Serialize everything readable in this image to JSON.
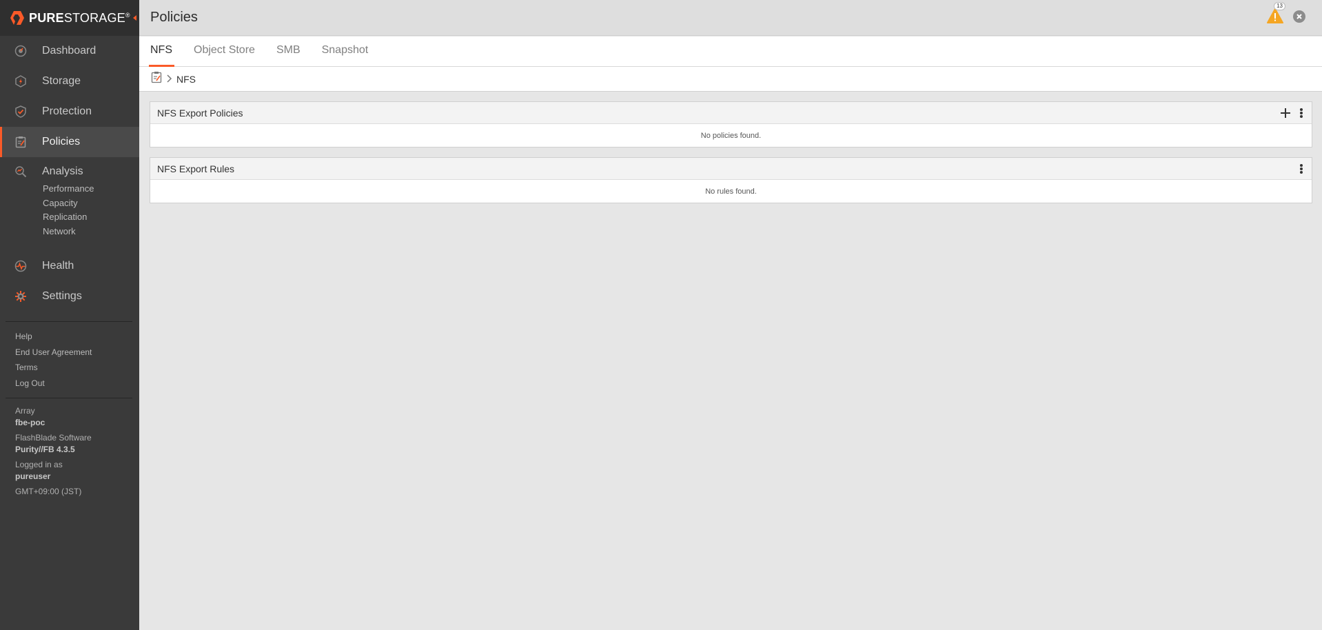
{
  "brand": {
    "name_bold": "PURE",
    "name_regular": "STORAGE",
    "mark": "®",
    "accent": "#fa5a28"
  },
  "sidebar": {
    "items": [
      {
        "label": "Dashboard",
        "icon": "dashboard-icon"
      },
      {
        "label": "Storage",
        "icon": "storage-icon"
      },
      {
        "label": "Protection",
        "icon": "protection-icon"
      },
      {
        "label": "Policies",
        "icon": "policies-icon",
        "active": true
      },
      {
        "label": "Analysis",
        "icon": "analysis-icon"
      },
      {
        "label": "Health",
        "icon": "health-icon"
      },
      {
        "label": "Settings",
        "icon": "settings-icon"
      }
    ],
    "analysis_sub": [
      "Performance",
      "Capacity",
      "Replication",
      "Network"
    ],
    "links": [
      "Help",
      "End User Agreement",
      "Terms",
      "Log Out"
    ],
    "info": {
      "array_label": "Array",
      "array_value": "fbe-poc",
      "software_label": "FlashBlade Software",
      "software_value": "Purity//FB 4.3.5",
      "logged_label": "Logged in as",
      "logged_value": "pureuser",
      "timezone": "GMT+09:00 (JST)"
    }
  },
  "header": {
    "title": "Policies",
    "alert_count": "13"
  },
  "tabs": [
    {
      "label": "NFS",
      "active": true
    },
    {
      "label": "Object Store"
    },
    {
      "label": "SMB"
    },
    {
      "label": "Snapshot"
    }
  ],
  "breadcrumb": {
    "current": "NFS"
  },
  "panels": {
    "policies": {
      "title": "NFS Export Policies",
      "empty": "No policies found."
    },
    "rules": {
      "title": "NFS Export Rules",
      "empty": "No rules found."
    }
  }
}
